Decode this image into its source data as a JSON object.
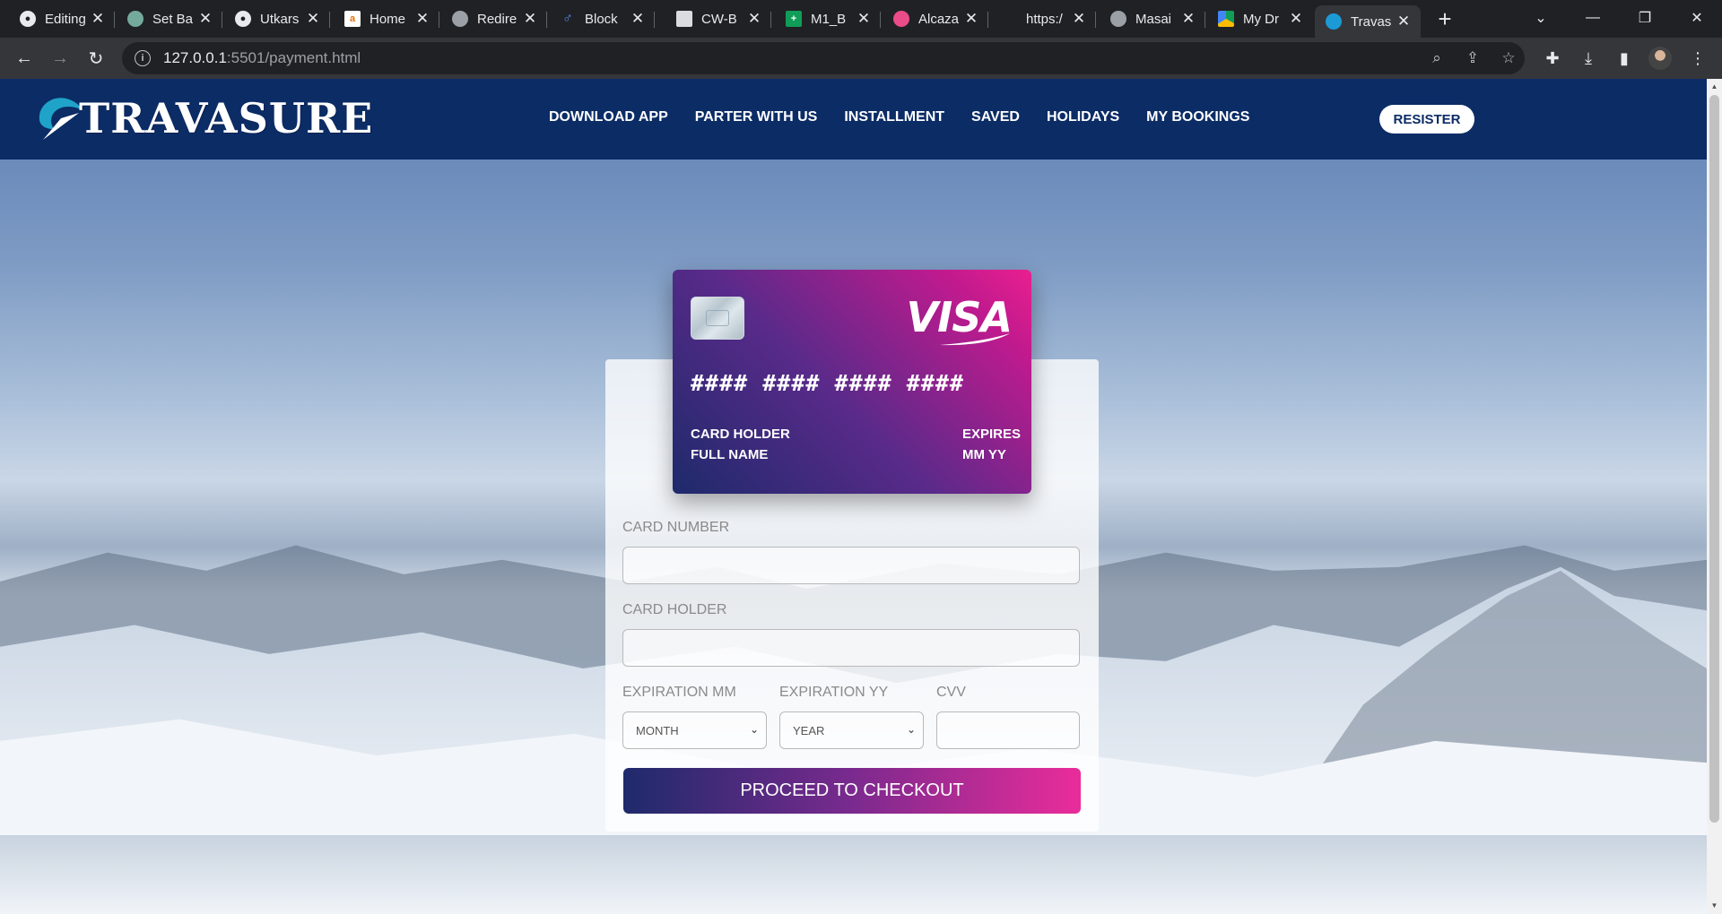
{
  "browser": {
    "tabs": [
      {
        "title": "Editing",
        "icon": "github-icon"
      },
      {
        "title": "Set Ba",
        "icon": "chatgpt-icon"
      },
      {
        "title": "Utkars",
        "icon": "github-icon"
      },
      {
        "title": "Home",
        "icon": "page-icon"
      },
      {
        "title": "Redire",
        "icon": "globe-icon"
      },
      {
        "title": "Block",
        "icon": "person-icon"
      },
      {
        "title": "CW-B",
        "icon": "doc-icon"
      },
      {
        "title": "M1_B",
        "icon": "sheets-icon"
      },
      {
        "title": "Alcaza",
        "icon": "dribbble-icon"
      },
      {
        "title": "https:/",
        "icon": "blank-icon"
      },
      {
        "title": "Masai",
        "icon": "globe-icon"
      },
      {
        "title": "My Dr",
        "icon": "drive-icon"
      },
      {
        "title": "Travas",
        "icon": "travasure-icon",
        "active": true
      }
    ],
    "url_host": "127.0.0.1",
    "url_rest": ":5501/payment.html"
  },
  "site": {
    "logo_text": "TRAVASURE",
    "nav": [
      "DOWNLOAD APP",
      "PARTER WITH US",
      "INSTALLMENT",
      "SAVED",
      "HOLIDAYS",
      "MY BOOKINGS"
    ],
    "register_label": "RESISTER"
  },
  "card": {
    "brand": "VISA",
    "number": "#### #### #### ####",
    "holder_label": "CARD HOLDER",
    "holder_value": "FULL NAME",
    "expires_label": "EXPIRES",
    "expires_value": "MM YY"
  },
  "form": {
    "card_number_label": "CARD NUMBER",
    "card_holder_label": "CARD HOLDER",
    "exp_mm_label": "EXPIRATION MM",
    "exp_yy_label": "EXPIRATION YY",
    "cvv_label": "CVV",
    "month_selected": "MONTH",
    "year_selected": "YEAR",
    "submit_label": "PROCEED TO CHECKOUT"
  },
  "colors": {
    "header_bg": "#0c2c66",
    "card_gradient_start": "#1e2a6b",
    "card_gradient_end": "#ea1f8f"
  }
}
